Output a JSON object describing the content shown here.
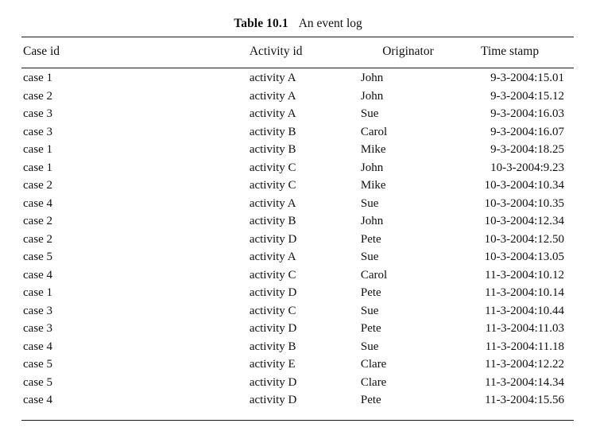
{
  "caption": {
    "label": "Table 10.1",
    "text": "An event log"
  },
  "table": {
    "columns": [
      {
        "key": "case_id",
        "header": "Case id"
      },
      {
        "key": "activity_id",
        "header": "Activity id"
      },
      {
        "key": "originator",
        "header": "Originator"
      },
      {
        "key": "time_stamp",
        "header": "Time stamp"
      }
    ],
    "rows": [
      {
        "case_id": "case 1",
        "activity_id": "activity A",
        "originator": "John",
        "time_stamp": "9-3-2004:15.01"
      },
      {
        "case_id": "case 2",
        "activity_id": "activity A",
        "originator": "John",
        "time_stamp": "9-3-2004:15.12"
      },
      {
        "case_id": "case 3",
        "activity_id": "activity A",
        "originator": "Sue",
        "time_stamp": "9-3-2004:16.03"
      },
      {
        "case_id": "case 3",
        "activity_id": "activity B",
        "originator": "Carol",
        "time_stamp": "9-3-2004:16.07"
      },
      {
        "case_id": "case 1",
        "activity_id": "activity B",
        "originator": "Mike",
        "time_stamp": "9-3-2004:18.25"
      },
      {
        "case_id": "case 1",
        "activity_id": "activity C",
        "originator": "John",
        "time_stamp": "10-3-2004:9.23"
      },
      {
        "case_id": "case 2",
        "activity_id": "activity C",
        "originator": "Mike",
        "time_stamp": "10-3-2004:10.34"
      },
      {
        "case_id": "case 4",
        "activity_id": "activity A",
        "originator": "Sue",
        "time_stamp": "10-3-2004:10.35"
      },
      {
        "case_id": "case 2",
        "activity_id": "activity B",
        "originator": "John",
        "time_stamp": "10-3-2004:12.34"
      },
      {
        "case_id": "case 2",
        "activity_id": "activity D",
        "originator": "Pete",
        "time_stamp": "10-3-2004:12.50"
      },
      {
        "case_id": "case 5",
        "activity_id": "activity A",
        "originator": "Sue",
        "time_stamp": "10-3-2004:13.05"
      },
      {
        "case_id": "case 4",
        "activity_id": "activity C",
        "originator": "Carol",
        "time_stamp": "11-3-2004:10.12"
      },
      {
        "case_id": "case 1",
        "activity_id": "activity D",
        "originator": "Pete",
        "time_stamp": "11-3-2004:10.14"
      },
      {
        "case_id": "case 3",
        "activity_id": "activity C",
        "originator": "Sue",
        "time_stamp": "11-3-2004:10.44"
      },
      {
        "case_id": "case 3",
        "activity_id": "activity D",
        "originator": "Pete",
        "time_stamp": "11-3-2004:11.03"
      },
      {
        "case_id": "case 4",
        "activity_id": "activity B",
        "originator": "Sue",
        "time_stamp": "11-3-2004:11.18"
      },
      {
        "case_id": "case 5",
        "activity_id": "activity E",
        "originator": "Clare",
        "time_stamp": "11-3-2004:12.22"
      },
      {
        "case_id": "case 5",
        "activity_id": "activity D",
        "originator": "Clare",
        "time_stamp": "11-3-2004:14.34"
      },
      {
        "case_id": "case 4",
        "activity_id": "activity D",
        "originator": "Pete",
        "time_stamp": "11-3-2004:15.56"
      }
    ]
  },
  "style": {
    "rule_color": "#1a1a1a",
    "text_color": "#101010",
    "background": "#ffffff"
  }
}
